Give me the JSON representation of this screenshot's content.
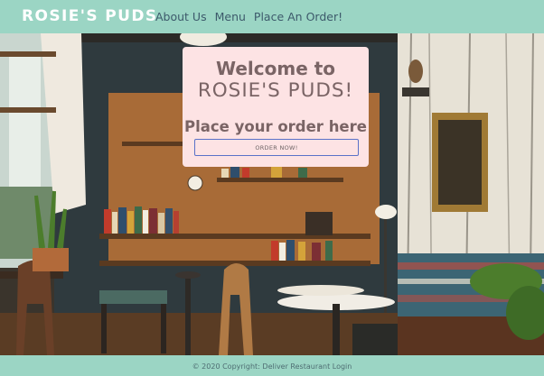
{
  "navbar": {
    "brand": "ROSIE'S PUDS",
    "links": [
      {
        "label": "About Us"
      },
      {
        "label": "Menu"
      },
      {
        "label": "Place An Order!"
      }
    ]
  },
  "card": {
    "title_line1": "Welcome to",
    "title_line2": "ROSIE'S PUDS!",
    "subtitle": "Place your order here",
    "button_label": "ORDER NOW!"
  },
  "footer": {
    "copyright": "© 2020 Copyright: Deliver Restaurant Login"
  },
  "colors": {
    "bar_background": "#9bd5c4",
    "card_background": "#fde3e4",
    "card_text": "#7a6465",
    "button_border": "#5a72c8"
  }
}
